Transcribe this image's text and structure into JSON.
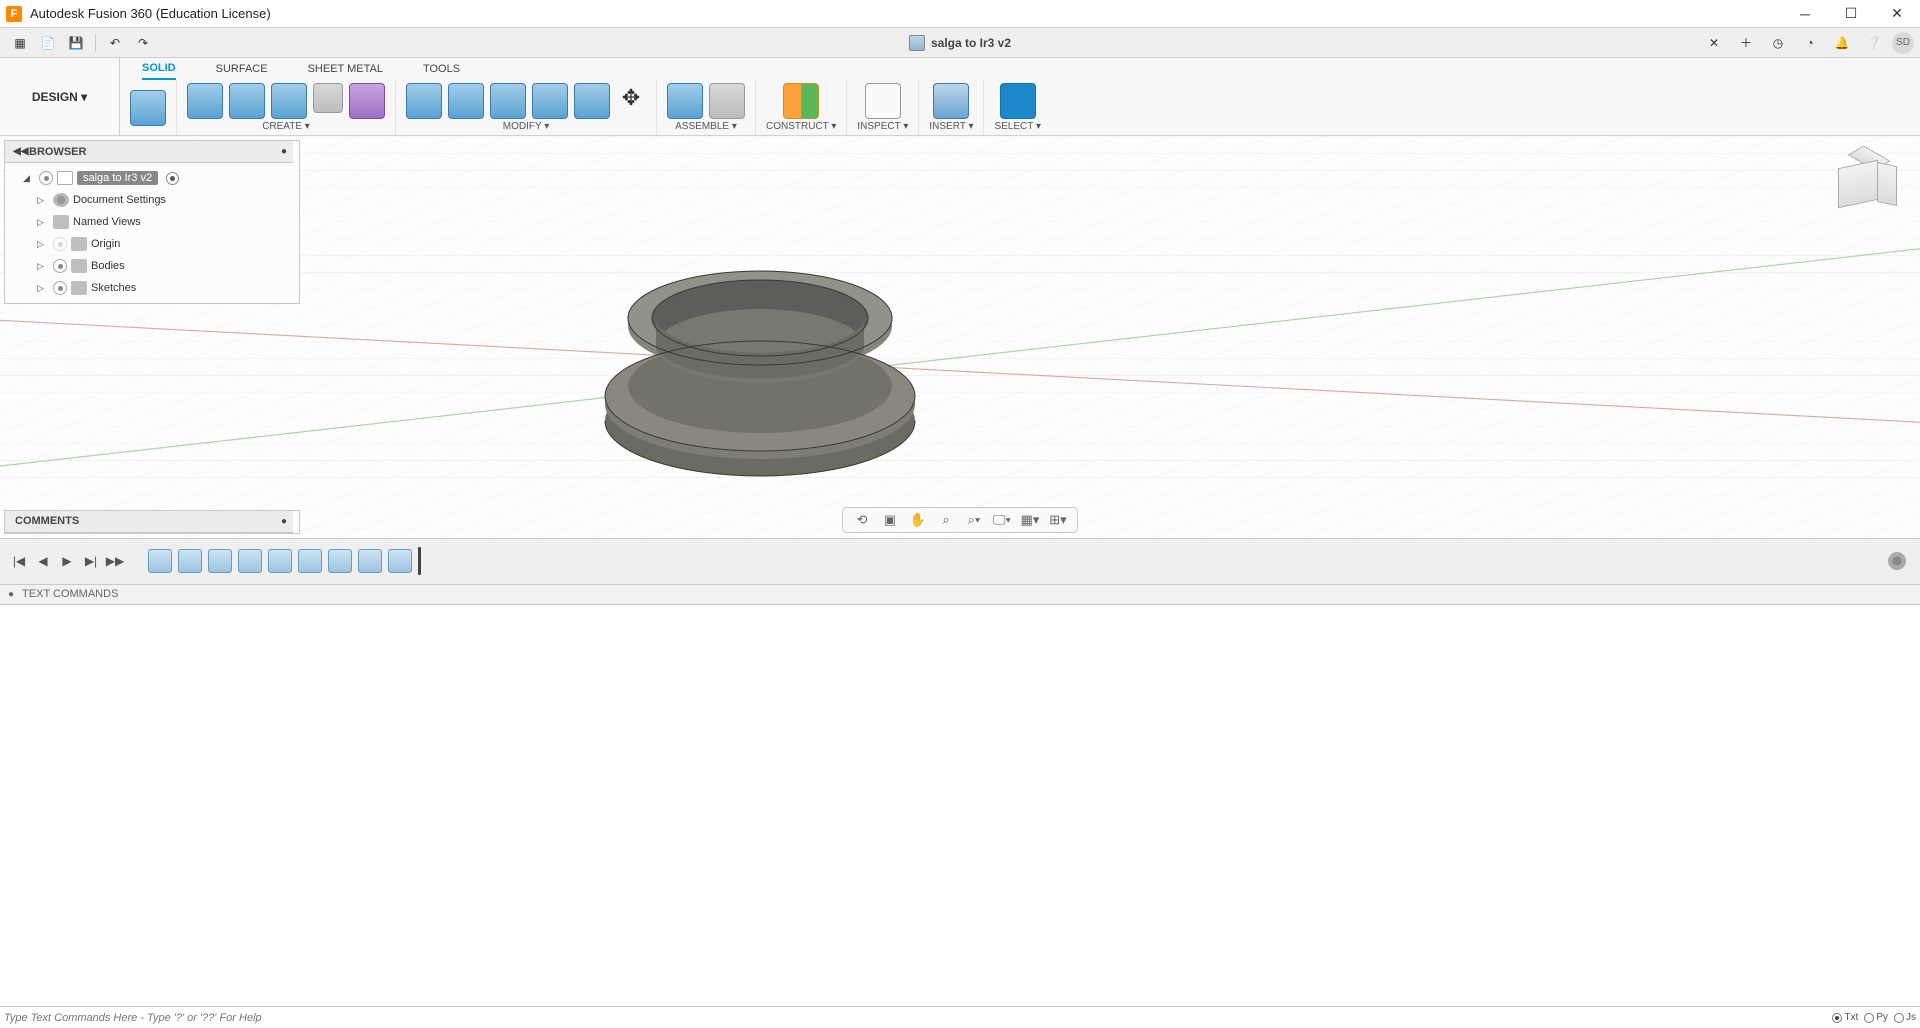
{
  "titlebar": {
    "title": "Autodesk Fusion 360 (Education License)"
  },
  "qat": {
    "doc_name": "salga to Ir3 v2",
    "avatar": "SD"
  },
  "ribbon": {
    "design_label": "DESIGN ▾",
    "tabs": {
      "solid": "SOLID",
      "surface": "SURFACE",
      "sheetmetal": "SHEET METAL",
      "tools": "TOOLS"
    },
    "groups": {
      "create": "CREATE ▾",
      "modify": "MODIFY ▾",
      "assemble": "ASSEMBLE ▾",
      "construct": "CONSTRUCT ▾",
      "inspect": "INSPECT ▾",
      "insert": "INSERT ▾",
      "select": "SELECT ▾"
    }
  },
  "browser": {
    "title": "BROWSER",
    "root": "salga to Ir3 v2",
    "items": {
      "docset": "Document Settings",
      "views": "Named Views",
      "origin": "Origin",
      "bodies": "Bodies",
      "sketches": "Sketches"
    }
  },
  "comments": {
    "title": "COMMENTS"
  },
  "textcmd": {
    "title": "TEXT COMMANDS",
    "placeholder": "Type Text Commands Here - Type '?' or '??' For Help"
  },
  "cmd_toggles": {
    "txt": "Txt",
    "py": "Py",
    "js": "Js"
  }
}
